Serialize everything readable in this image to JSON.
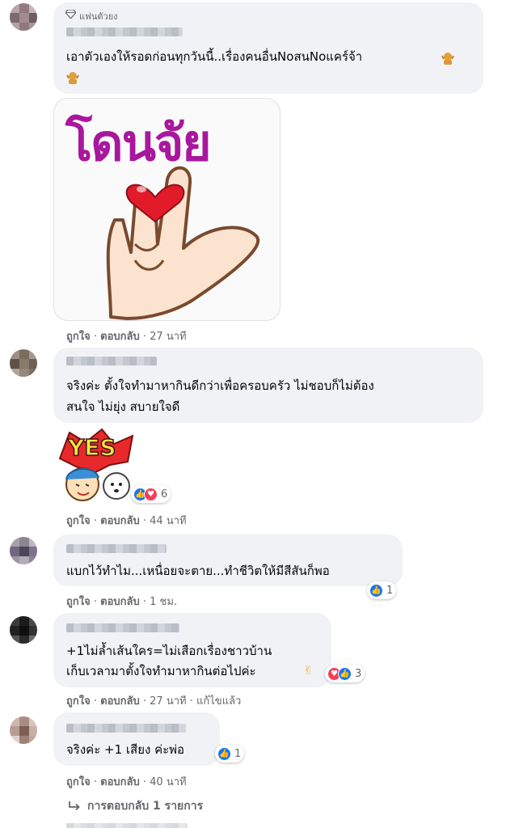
{
  "comments": [
    {
      "badge_label": "แฟนตัวยง",
      "text_lines": [
        "เอาตัวเองให้รอดก่อนทุกวันนี้..เรื่องคนอื่นNoสนNoแคร์จ้า"
      ],
      "sticker_text": "โดนจัย",
      "actions": {
        "like": "ถูกใจ",
        "reply": "ตอบกลับ",
        "time": "27 นาที"
      }
    },
    {
      "text_lines": [
        "จริงค่ะ ตั้งใจทำมาหากินดีกว่าเพื่อครอบครัว ไม่ชอบก็ไม่ต้อง",
        "สนใจ ไม่ยุ่ง สบายใจดี"
      ],
      "sticker_text": "YES",
      "reaction_count": "6",
      "actions": {
        "like": "ถูกใจ",
        "reply": "ตอบกลับ",
        "time": "44 นาที"
      }
    },
    {
      "text_lines": [
        "แบกไว้ทำไม...เหนื่อยจะตาย...ทำชีวิตให้มีสีสันก็พอ"
      ],
      "reaction_count": "1",
      "actions": {
        "like": "ถูกใจ",
        "reply": "ตอบกลับ",
        "time": "1 ชม."
      }
    },
    {
      "text_lines": [
        "+1ไม่ล้ำเส้นใคร=ไม่เสือกเรื่องชาวบ้าน",
        "เก็บเวลามาตั้งใจทำมาหากินต่อไปค่ะ"
      ],
      "reaction_count": "3",
      "actions": {
        "like": "ถูกใจ",
        "reply": "ตอบกลับ",
        "time": "27 นาที",
        "edited": "แก้ไขแล้ว"
      }
    },
    {
      "text_lines": [
        "จริงค่ะ +1 เสียง ค่ะพ่อ"
      ],
      "reaction_count": "1",
      "actions": {
        "like": "ถูกใจ",
        "reply": "ตอบกลับ",
        "time": "40 นาที"
      }
    }
  ],
  "view_replies": "การตอบกลับ 1 รายการ",
  "separator": "·",
  "colors": {
    "bubble": "#f0f2f5",
    "secondary_text": "#65676b",
    "like_blue": "#1877f2",
    "love_red": "#f33e58"
  },
  "icons": [
    "diamond-icon",
    "shrug-emoji-icon",
    "like-reaction-icon",
    "love-reaction-icon",
    "victory-hand-emoji-icon",
    "reply-arrow-icon"
  ]
}
